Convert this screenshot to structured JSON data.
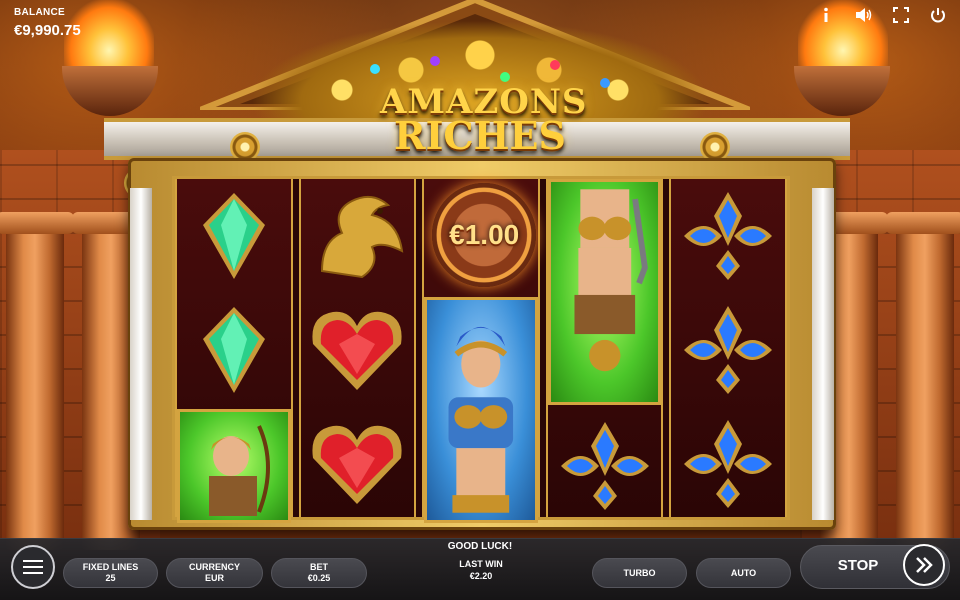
{
  "game": {
    "logo_line1": "AMAZONS",
    "logo_line2": "RICHES"
  },
  "hud": {
    "balance_label": "BALANCE",
    "balance_value": "€9,990.75",
    "icons": [
      "info-icon",
      "sound-icon",
      "fullscreen-icon",
      "power-icon"
    ]
  },
  "reels": {
    "coin_value": "€1.00",
    "symbols": [
      [
        "green-crystal",
        "green-crystal",
        "archer-amazon"
      ],
      [
        "golden-griffin",
        "red-heart-gem",
        "red-heart-gem"
      ],
      [
        "coin-bonus",
        "blue-warrior-amazon",
        "blue-warrior-amazon"
      ],
      [
        "green-warrior-amazon",
        "green-warrior-amazon",
        "blue-fleur-gem"
      ],
      [
        "blue-fleur-gem",
        "blue-fleur-gem",
        "blue-fleur-gem"
      ]
    ]
  },
  "bottom_bar": {
    "status": "GOOD LUCK!",
    "fixed_lines_label": "FIXED LINES",
    "fixed_lines_value": "25",
    "currency_label": "CURRENCY",
    "currency_value": "EUR",
    "bet_label": "BET",
    "bet_value": "€0.25",
    "last_win_label": "LAST WIN",
    "last_win_value": "€2.20",
    "turbo_label": "TURBO",
    "auto_label": "AUTO",
    "stop_label": "STOP"
  },
  "colors": {
    "gold": "#d4a440",
    "reel_background": "#2a0606",
    "bar_background": "#28282c"
  }
}
